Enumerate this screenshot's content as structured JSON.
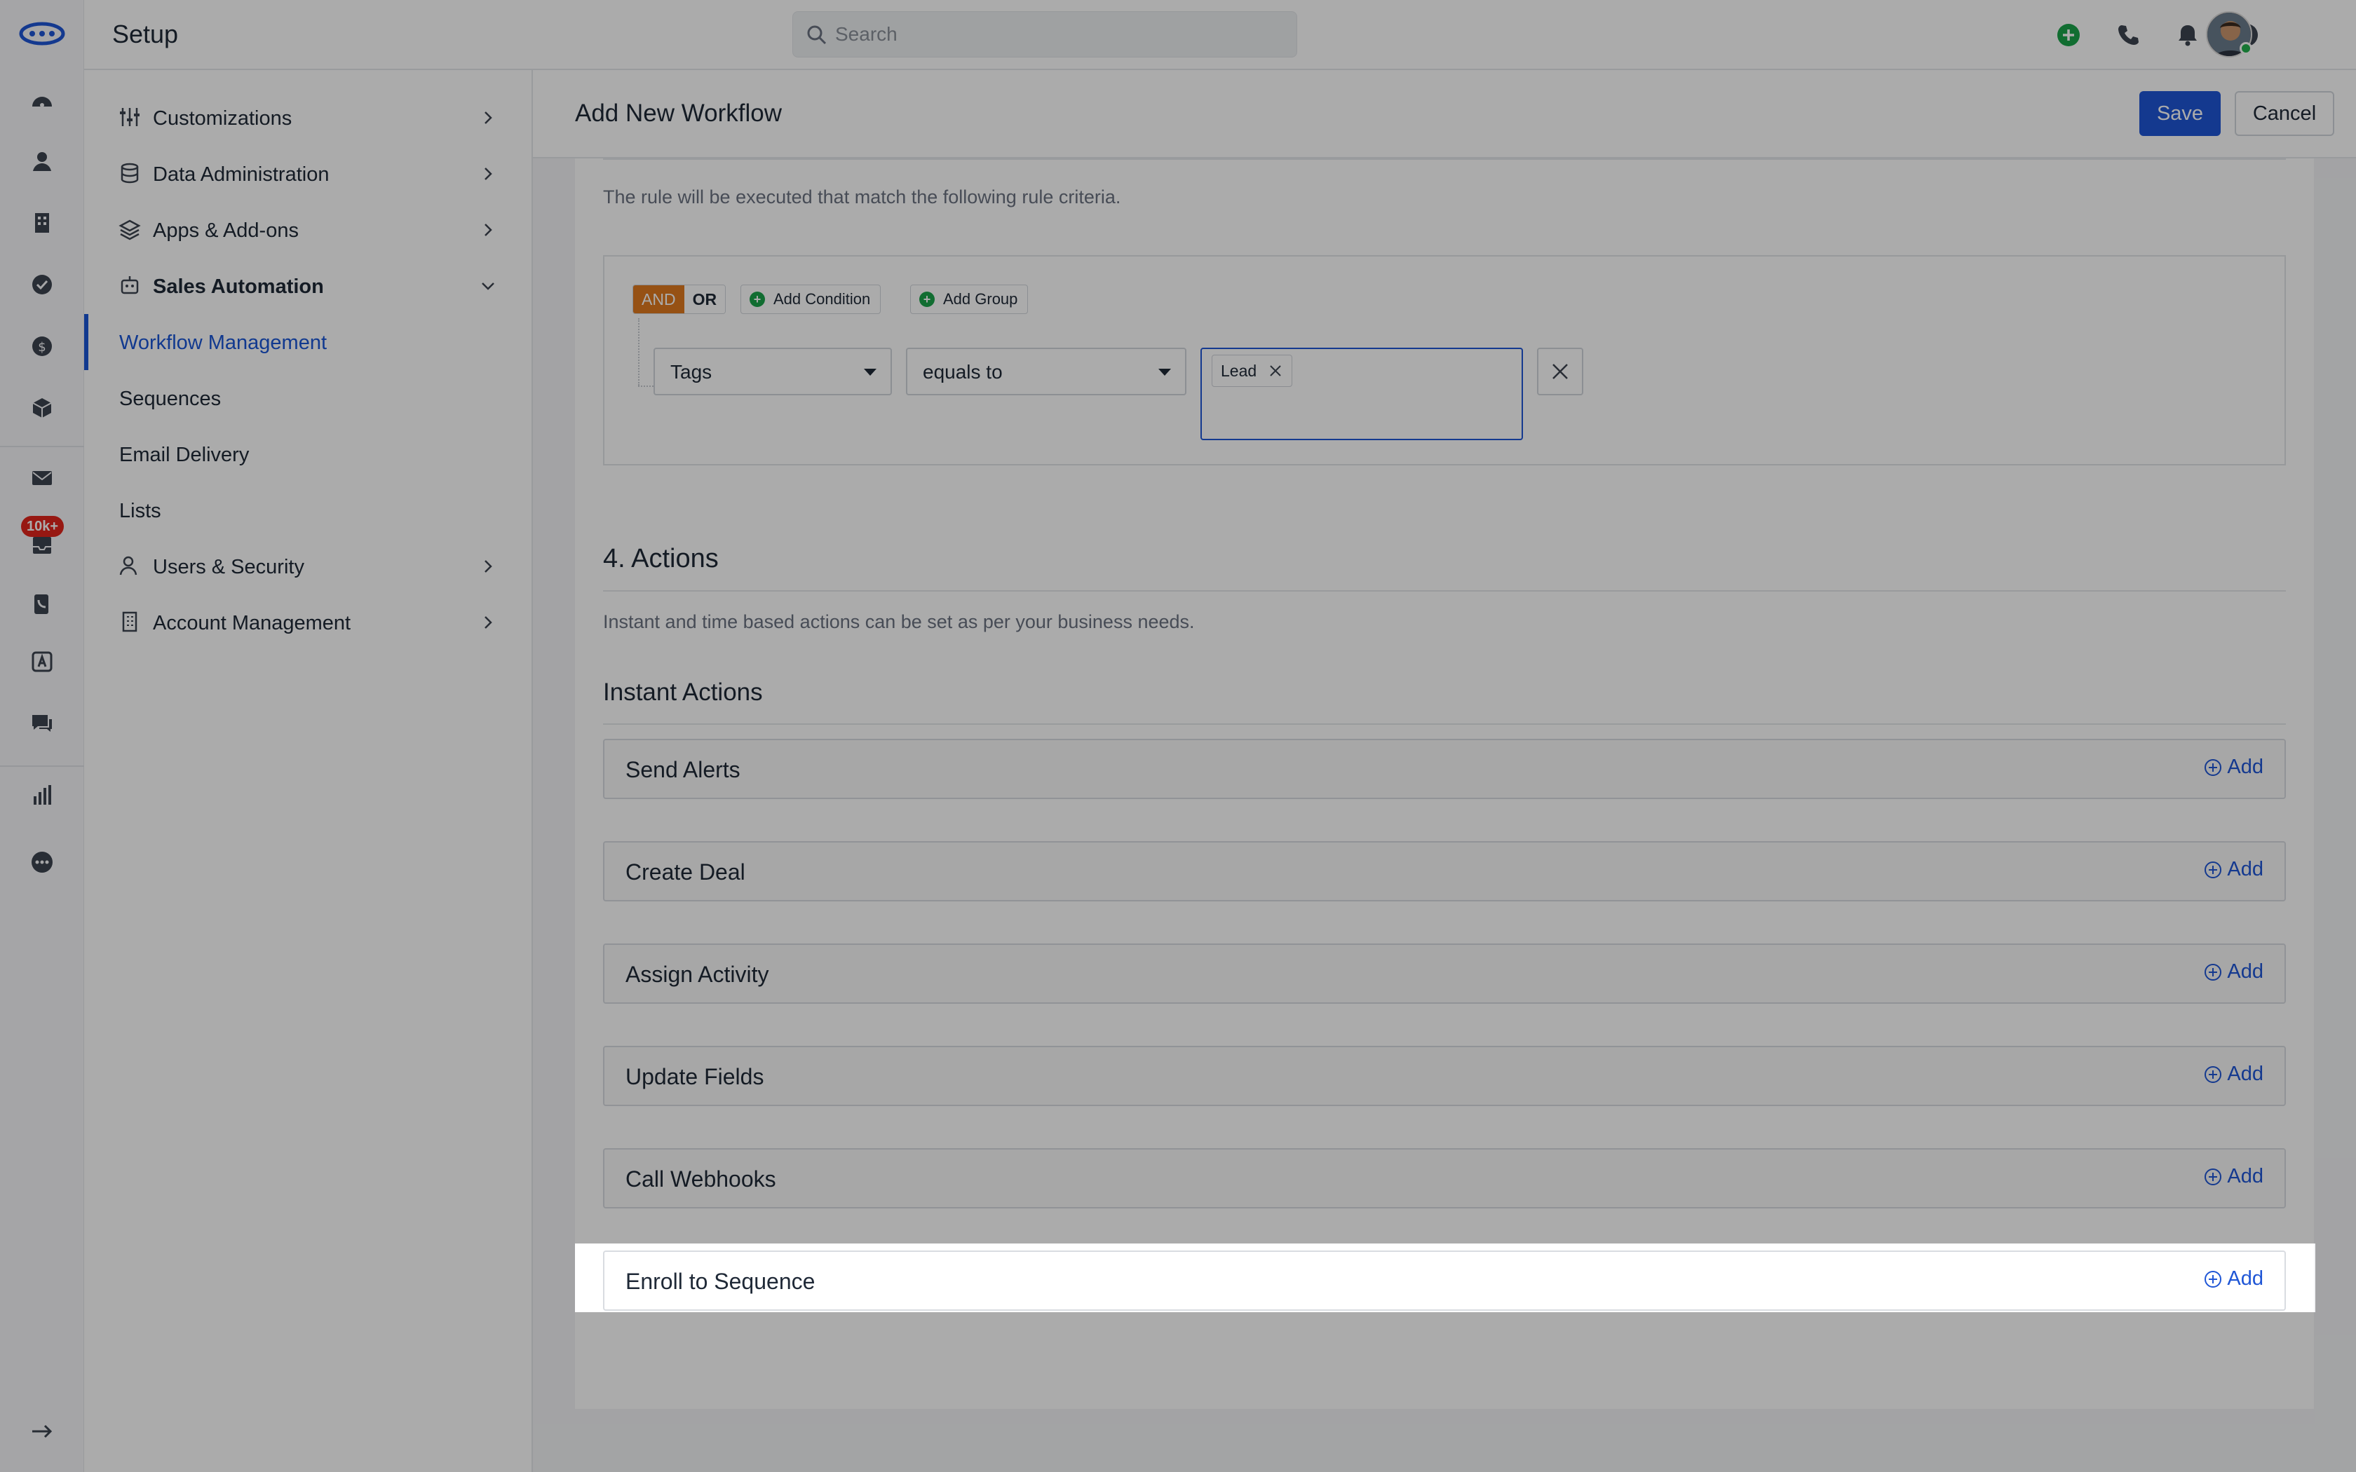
{
  "app": {
    "title": "Setup"
  },
  "search": {
    "placeholder": "Search"
  },
  "rail": {
    "badge": "10k+"
  },
  "sidebar": {
    "items": [
      {
        "label": "Customizations"
      },
      {
        "label": "Data Administration"
      },
      {
        "label": "Apps & Add-ons"
      },
      {
        "label": "Sales Automation"
      },
      {
        "label": "Users & Security"
      },
      {
        "label": "Account Management"
      }
    ],
    "sub_items": [
      {
        "label": "Workflow Management"
      },
      {
        "label": "Sequences"
      },
      {
        "label": "Email Delivery"
      },
      {
        "label": "Lists"
      }
    ]
  },
  "header": {
    "title": "Add New Workflow",
    "save": "Save",
    "cancel": "Cancel"
  },
  "criteria": {
    "description": "The rule will be executed that match the following rule criteria.",
    "and": "AND",
    "or": "OR",
    "add_condition": "Add Condition",
    "add_group": "Add Group",
    "field": "Tags",
    "operator": "equals to",
    "tag": "Lead"
  },
  "actions": {
    "title": "4. Actions",
    "description": "Instant and time based actions can be set as per your business needs.",
    "instant_title": "Instant Actions",
    "add_label": "Add",
    "rows": [
      {
        "label": "Send Alerts"
      },
      {
        "label": "Create Deal"
      },
      {
        "label": "Assign Activity"
      },
      {
        "label": "Update Fields"
      },
      {
        "label": "Call Webhooks"
      },
      {
        "label": "Enroll to Sequence"
      }
    ]
  },
  "colors": {
    "primary": "#1f56d6",
    "and_orange": "#e07a1f",
    "green": "#1aa34a",
    "badge_red": "#e1251b"
  }
}
